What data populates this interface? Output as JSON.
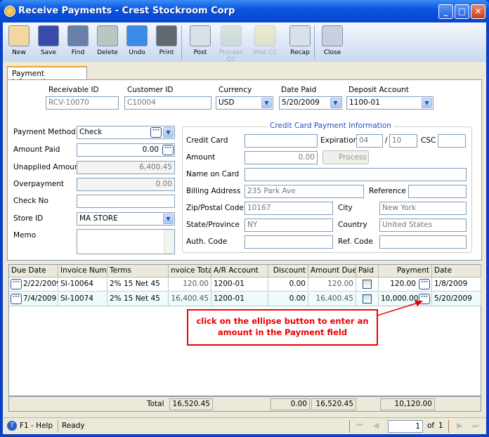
{
  "window": {
    "title": "Receive Payments - Crest Stockroom Corp"
  },
  "toolbar": [
    {
      "label": "New",
      "icon": "new-icon",
      "enabled": true
    },
    {
      "label": "Save",
      "icon": "save-icon",
      "enabled": true
    },
    {
      "label": "Find",
      "icon": "find-icon",
      "enabled": true
    },
    {
      "label": "Delete",
      "icon": "delete-icon",
      "enabled": true
    },
    {
      "label": "Undo",
      "icon": "undo-icon",
      "enabled": true
    },
    {
      "label": "Print",
      "icon": "print-icon",
      "enabled": true
    },
    {
      "label": "Post",
      "icon": "post-icon",
      "enabled": true
    },
    {
      "label": "Process CC",
      "icon": "process-cc-icon",
      "enabled": false
    },
    {
      "label": "Void CC",
      "icon": "void-cc-icon",
      "enabled": false
    },
    {
      "label": "Recap",
      "icon": "recap-icon",
      "enabled": true
    },
    {
      "label": "Close",
      "icon": "close-icon",
      "enabled": true
    }
  ],
  "tab": "Payment Information",
  "header": {
    "receivable_id_label": "Receivable ID",
    "receivable_id": "RCV-10070",
    "customer_id_label": "Customer ID",
    "customer_id": "C10004",
    "currency_label": "Currency",
    "currency": "USD",
    "date_paid_label": "Date Paid",
    "date_paid": "5/20/2009",
    "deposit_account_label": "Deposit Account",
    "deposit_account": "1100-01"
  },
  "left": {
    "payment_method_label": "Payment Method",
    "payment_method": "Check",
    "amount_paid_label": "Amount Paid",
    "amount_paid": "0.00",
    "unapplied_label": "Unapplied Amount",
    "unapplied": "6,400.45",
    "overpayment_label": "Overpayment",
    "overpayment": "0.00",
    "check_no_label": "Check No",
    "check_no": "",
    "store_id_label": "Store ID",
    "store_id": "MA STORE",
    "memo_label": "Memo",
    "memo": ""
  },
  "cc": {
    "title": "Credit Card Payment Information",
    "credit_card_label": "Credit Card",
    "credit_card": "",
    "expiration_label": "Expiration",
    "exp_month": "04",
    "exp_sep": "/",
    "exp_year": "10",
    "csc_label": "CSC",
    "csc": "",
    "amount_label": "Amount",
    "amount": "0.00",
    "process_label": "Process",
    "name_label": "Name on Card",
    "name": "",
    "billing_label": "Billing Address",
    "billing": "235 Park Ave",
    "reference_label": "Reference",
    "reference": "",
    "zip_label": "Zip/Postal Code",
    "zip": "10167",
    "city_label": "City",
    "city": "New York",
    "state_label": "State/Province",
    "state": "NY",
    "country_label": "Country",
    "country": "United States",
    "auth_label": "Auth. Code",
    "auth": "",
    "ref_code_label": "Ref. Code",
    "ref_code": ""
  },
  "grid": {
    "columns": [
      "Due Date",
      "Invoice Numb",
      "Terms",
      "nvoice Total",
      "A/R Account",
      "Discount",
      "Amount Due",
      "Paid",
      "Payment",
      "Date"
    ],
    "rows": [
      [
        "2/22/2009",
        "SI-10064",
        "2% 15 Net 45",
        "120.00",
        "1200-01",
        "0.00",
        "120.00",
        false,
        "120.00",
        "1/8/2009"
      ],
      [
        "7/4/2009",
        "SI-10074",
        "2% 15 Net 45",
        "16,400.45",
        "1200-01",
        "0.00",
        "16,400.45",
        false,
        "10,000.00",
        "5/20/2009"
      ]
    ],
    "totals": {
      "label": "Total",
      "invoice_total": "16,520.45",
      "discount": "0.00",
      "amount_due": "16,520.45",
      "payment": "10,120.00"
    }
  },
  "callout": "click on the ellipse button to enter an amount in the Payment field",
  "status": {
    "help": "F1 - Help",
    "state": "Ready",
    "page": "1",
    "of_label": "of",
    "pages": "1"
  },
  "colors": {
    "titlebar": "#0a55e0",
    "callout": "#e00000",
    "selected_row": "#eefcfc"
  }
}
